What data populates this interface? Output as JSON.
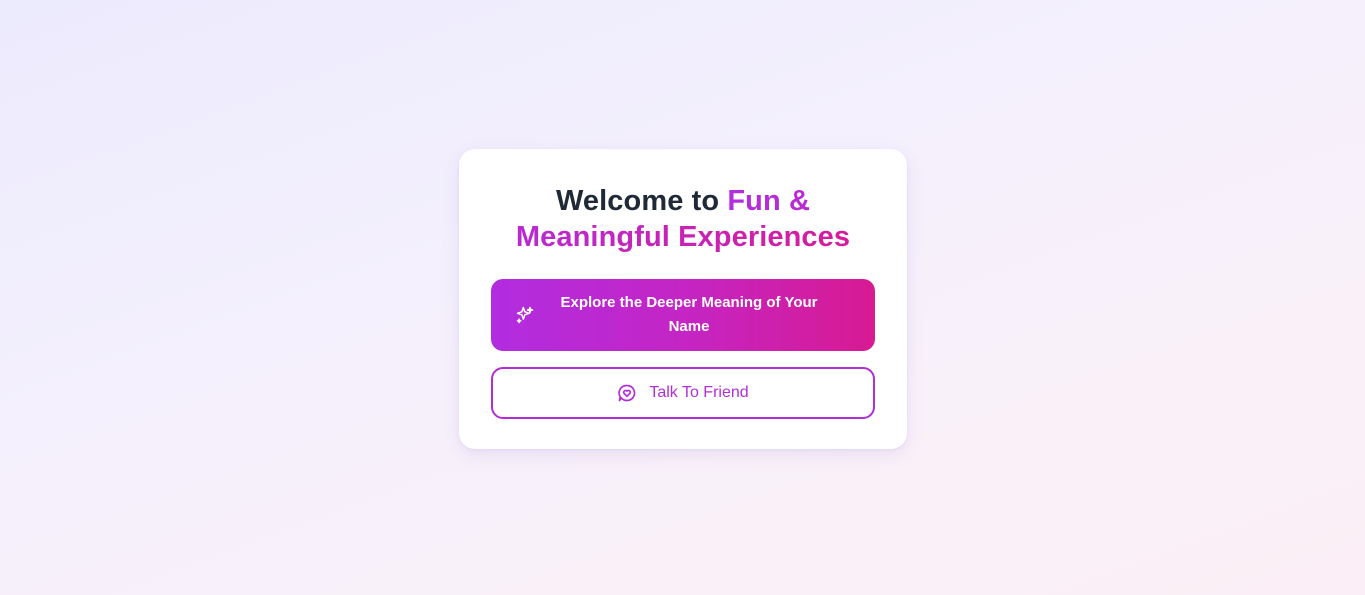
{
  "welcome": {
    "title_prefix": "Welcome to",
    "title_accent": "Fun & Meaningful Experiences"
  },
  "actions": {
    "explore_label": "Explore the Deeper Meaning of Your Name",
    "explore_icon": "sparkles-icon",
    "talk_label": "Talk To Friend",
    "talk_icon": "chat-heart-icon"
  },
  "colors": {
    "accent_start": "#b22ee0",
    "accent_end": "#d61c99",
    "title_text": "#1f2937"
  }
}
